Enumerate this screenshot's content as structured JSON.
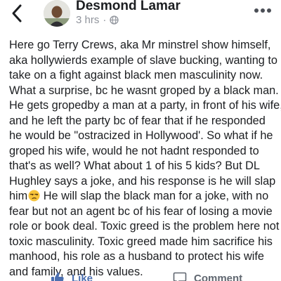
{
  "header": {
    "author_name": "Desmond Lamar",
    "timestamp": "3 hrs",
    "separator": "·",
    "back_icon": "chevron-left-icon",
    "audience_icon": "globe-icon",
    "more_icon": "more-horizontal-icon"
  },
  "post": {
    "lines": [
      "Here go Terry Crews, aka Mr minstrel show himself,",
      "aka hollywierds example of slave bucking, wanting to",
      "take on a fight against black men masculinity now.",
      "What a surprise, bc he wasnt groped by a black man.",
      "He gets gropedby a man at a party, in front of his wife,",
      "and he left the party bc of fear that if he responded",
      "he would be \"ostracized in Hollywood'. So what if he",
      "groped his wife, would he not hadnt responded to",
      "that's as well? What about 1 of his 5 kids? But DL",
      "Hughley says a joke, and his response is he will slap",
      "him",
      "He will slap the black man for a joke, with no",
      "fear but not an agent bc of his fear of losing a movie",
      "role or book deal. Toxic greed is the problem here not",
      "toxic masculinity. Toxic greed made him sacrifice his",
      "manhood, his role as a husband to protect his wife",
      "and family, and his values."
    ],
    "emoji_icon": "unamused-face-emoji-icon"
  },
  "actions": {
    "like_label": "Like",
    "comment_label": "Comment",
    "like_icon": "thumbs-up-icon",
    "comment_icon": "comment-bubble-icon"
  },
  "colors": {
    "text": "#1c1e21",
    "secondary_text": "#90949c",
    "like_blue": "#4b6fb0",
    "action_gray": "#606770"
  }
}
